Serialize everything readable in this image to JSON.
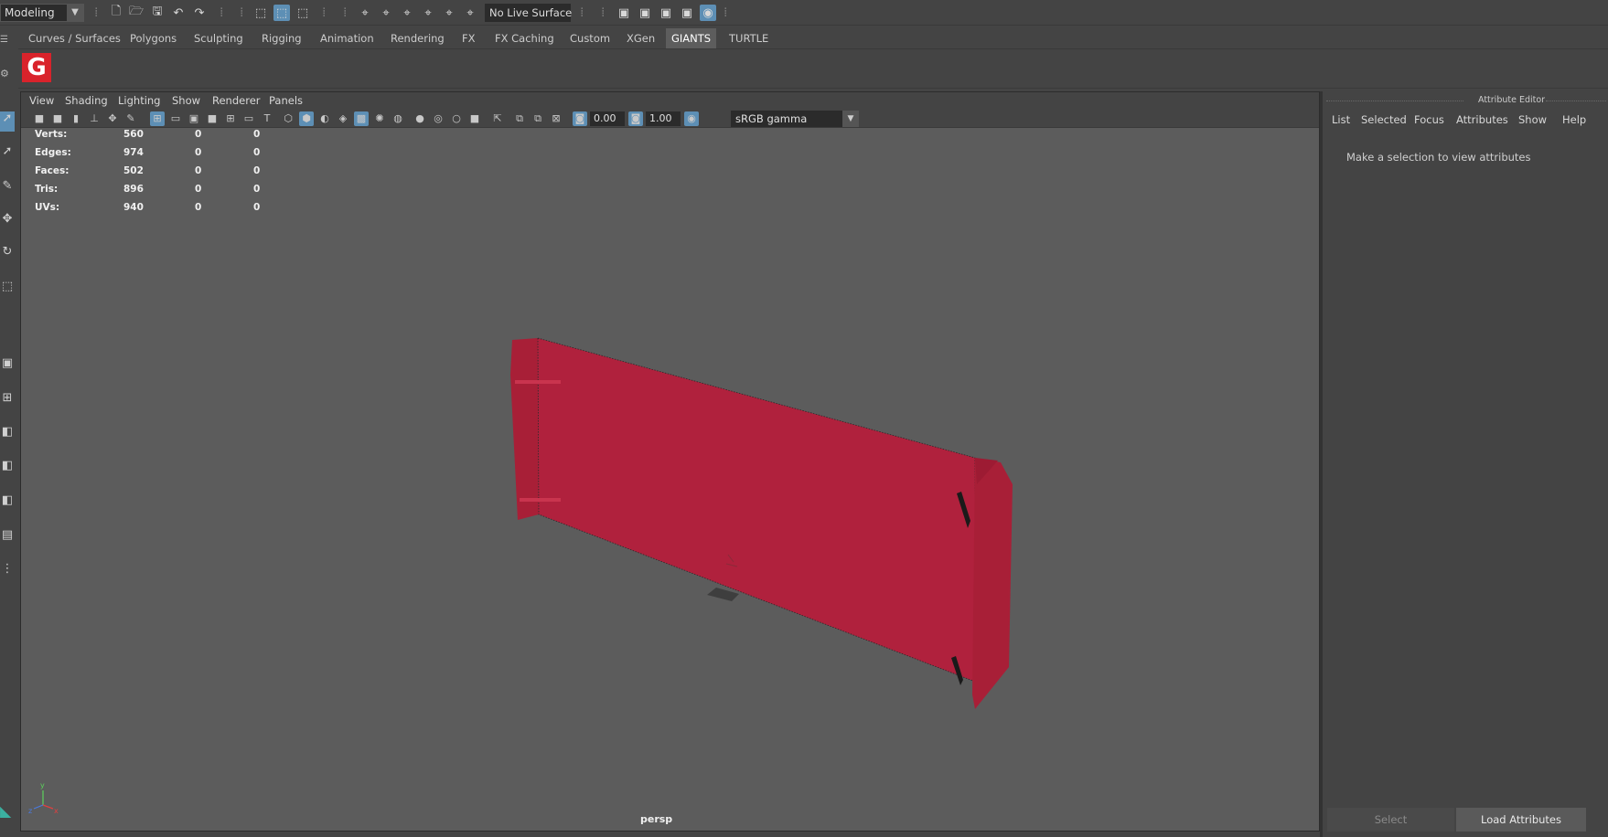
{
  "status_line": {
    "mode_menu": "Modeling",
    "live_surface": "No Live Surface",
    "icons": [
      "new-scene-icon",
      "open-scene-icon",
      "save-scene-icon",
      "undo-icon",
      "redo-icon",
      "select-by-hierarchy-icon",
      "select-by-object-icon",
      "select-by-component-icon",
      "snap-grid-icon",
      "snap-curve-icon",
      "snap-point-icon",
      "snap-view-plane-icon",
      "snap-surface-icon",
      "snap-live-icon",
      "render-current-frame-icon",
      "render-sequence-icon",
      "ipr-render-icon",
      "render-settings-icon",
      "hypershade-icon"
    ]
  },
  "shelf": {
    "tabs": [
      "Curves / Surfaces",
      "Polygons",
      "Sculpting",
      "Rigging",
      "Animation",
      "Rendering",
      "FX",
      "FX Caching",
      "Custom",
      "XGen",
      "GIANTS",
      "TURTLE"
    ],
    "selected_tab": "GIANTS",
    "giants_logo_letter": "G"
  },
  "viewport": {
    "panel_menu": [
      "View",
      "Shading",
      "Lighting",
      "Show",
      "Renderer",
      "Panels"
    ],
    "exposure": "0.00",
    "gamma": "1.00",
    "color_space": "sRGB gamma",
    "camera": "persp",
    "hud": [
      {
        "label": "Verts:",
        "v1": "560",
        "v2": "0",
        "v3": "0"
      },
      {
        "label": "Edges:",
        "v1": "974",
        "v2": "0",
        "v3": "0"
      },
      {
        "label": "Faces:",
        "v1": "502",
        "v2": "0",
        "v3": "0"
      },
      {
        "label": "Tris:",
        "v1": "896",
        "v2": "0",
        "v3": "0"
      },
      {
        "label": "UVs:",
        "v1": "940",
        "v2": "0",
        "v3": "0"
      }
    ],
    "axis_labels": {
      "x": "x",
      "y": "y",
      "z": "z"
    },
    "colors": {
      "background": "#5c5c5c",
      "model": "#b0213d",
      "model_dark": "#9d1b33"
    }
  },
  "attribute_editor": {
    "title": "Attribute Editor",
    "menu": [
      "List",
      "Selected",
      "Focus",
      "Attributes",
      "Show",
      "Help"
    ],
    "message": "Make a selection to view attributes",
    "select_button": "Select",
    "load_button": "Load Attributes"
  }
}
